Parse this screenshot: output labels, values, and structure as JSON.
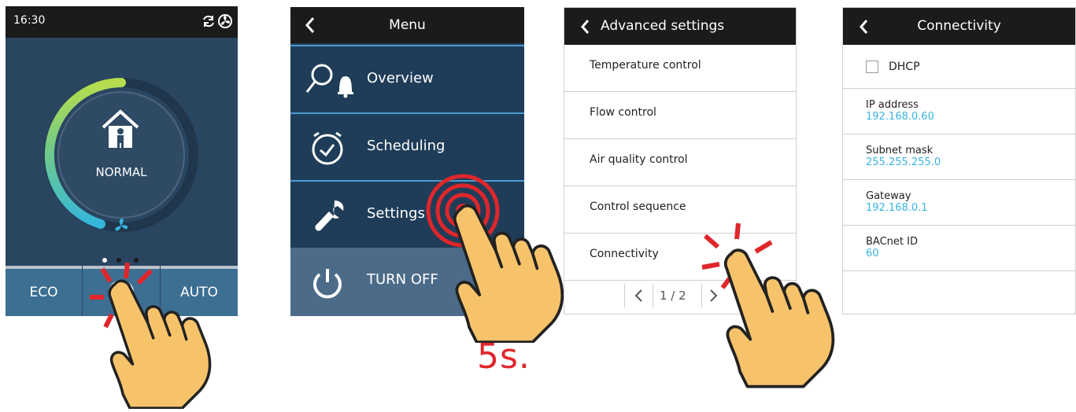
{
  "panel_home": {
    "time": "16:30",
    "mode_label": "NORMAL",
    "eco_label": "ECO",
    "auto_label": "AUTO"
  },
  "panel_menu": {
    "title": "Menu",
    "items": [
      "Overview",
      "Scheduling",
      "Settings",
      "TURN OFF"
    ]
  },
  "press_duration": "5s.",
  "panel_advanced": {
    "title": "Advanced settings",
    "items": [
      "Temperature control",
      "Flow control",
      "Air quality control",
      "Control sequence",
      "Connectivity"
    ],
    "pager": "1 / 2"
  },
  "panel_connectivity": {
    "title": "Connectivity",
    "dhcp_label": "DHCP",
    "fields": [
      {
        "label": "IP address",
        "value": "192.168.0.60"
      },
      {
        "label": "Subnet mask",
        "value": "255.255.255.0"
      },
      {
        "label": "Gateway",
        "value": "192.168.0.1"
      },
      {
        "label": "BACnet ID",
        "value": "60"
      }
    ]
  },
  "colors": {
    "accent_blue": "#39b4e0",
    "press_red": "#e0262b",
    "hand_fill": "#f7c36a"
  }
}
